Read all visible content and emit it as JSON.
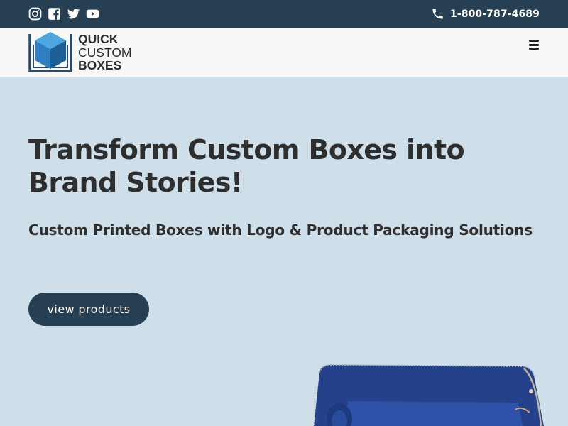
{
  "topbar": {
    "social_icons": [
      "instagram-icon",
      "facebook-icon",
      "twitter-icon",
      "youtube-icon"
    ],
    "phone_icon": "phone-icon",
    "phone_number": "1-800-787-4689"
  },
  "header": {
    "logo": {
      "line1": "QUICK",
      "line2": "CUSTOM",
      "line3": "BOXES"
    },
    "menu_icon": "hamburger-menu-icon"
  },
  "hero": {
    "title": "Transform Custom Boxes into Brand Stories!",
    "subtitle": "Custom Printed Boxes with Logo & Product Packaging Solutions",
    "cta_label": "view products"
  },
  "colors": {
    "topbar_bg": "#273f52",
    "header_bg": "#f7f7f7",
    "hero_bg": "#cfdfea",
    "button_bg": "#273f52",
    "heading_text": "#2e2e2e",
    "logo_blue": "#2f7fc0",
    "product_box": "#23408a"
  }
}
